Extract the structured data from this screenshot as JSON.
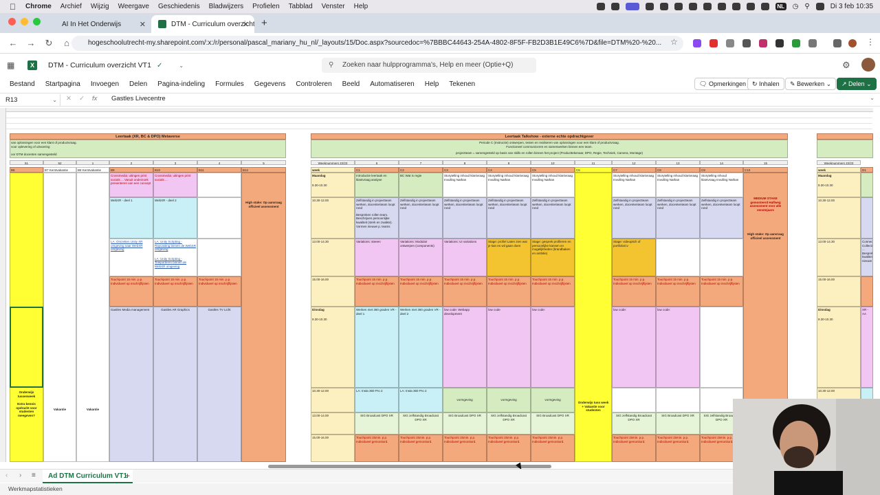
{
  "mac": {
    "menus": [
      "Chrome",
      "Archief",
      "Wijzig",
      "Weergave",
      "Geschiedenis",
      "Bladwijzers",
      "Profielen",
      "Tabblad",
      "Venster",
      "Help"
    ],
    "clock": "Di 3 feb 10:35",
    "input_lang": "NL"
  },
  "browser": {
    "tabs": [
      {
        "title": "AI In Het Onderwijs",
        "active": false
      },
      {
        "title": "DTM - Curriculum overzicht V",
        "active": true
      }
    ],
    "url": "hogeschoolutrecht-my.sharepoint.com/:x:/r/personal/pascal_mariany_hu_nl/_layouts/15/Doc.aspx?sourcedoc=%7BBBC44643-254A-4802-8F5F-FB2D3B1E49C6%7D&file=DTM%20-%20..."
  },
  "excel": {
    "doc_title": "DTM - Curriculum overzicht VT1",
    "search_placeholder": "Zoeken naar hulpprogramma's, Help en meer (Optie+Q)",
    "ribbon_tabs": [
      "Bestand",
      "Startpagina",
      "Invoegen",
      "Delen",
      "Pagina-indeling",
      "Formules",
      "Gegevens",
      "Controleren",
      "Beeld",
      "Automatiseren",
      "Help",
      "Tekenen"
    ],
    "btn_comments": "Opmerkingen",
    "btn_catchup": "Inhalen",
    "btn_edit": "Bewerken",
    "btn_share": "Delen",
    "name_box": "R13",
    "formula_value": "Gastles Livecentre",
    "sheet_tab": "Ad DTM Curriculum VT1",
    "status_text": "Werkmapstatistieken"
  },
  "sheet": {
    "left_title": "Leertaak (XR, BC & DPO) Metaverse",
    "left_sub1": "van oplossingen voor een klant of productvraag.",
    "left_sub2": "voor oplevering of uitvoering",
    "left_sub3": "oor DTM docenten samengesteld",
    "right_title": "Leertaak Talkshow - externe echte opdrachtgever",
    "right_sub1": "Periode C (Instructie) ontwerpen, testen en realiseren van oplossingen voor een klant of productvraag.",
    "right_sub2": "Functioneel communiceren en samenwerken binnen een team.",
    "right_sub3": "projectteam = samengesteld op basis van skills en rollen binnen het project (Producttekenaar, DPO, Regie, Techniek, Camera, Montage)",
    "weeknr_label": "Weeknummers 22/23",
    "week_label": "week",
    "left_weeks": [
      "51",
      "52",
      "1",
      "2",
      "3",
      "4",
      "5"
    ],
    "left_codes": [
      "B6",
      "B7 Kerstvakantie",
      "B8 Kerstvakantie",
      "B9",
      "B10",
      "B11",
      "B12"
    ],
    "right_weeks": [
      "6",
      "7",
      "8",
      "9",
      "10",
      "11",
      "12",
      "13",
      "14",
      "15"
    ],
    "right_codes": [
      "C1",
      "C2",
      "C3",
      "C4",
      "C5",
      "C6",
      "C7",
      "C8",
      "C9",
      "C10"
    ],
    "monday": "Maandag",
    "tuesday": "Dinsdag",
    "t1": "9.30-10.30",
    "t2": "10.30-12.00",
    "t3": "13.00-14.30",
    "t4": "15.00-16.00",
    "t5": "9.30-10.30",
    "t6": "10.30-12.00",
    "t7": "13.00-14.00",
    "t8": "15.00-16.00",
    "crossmedia": "Crossmedia: uitingen print socials ... Vanuit onderzoek presenteren van een concept",
    "crossmedia2": "Crossmedia: uitingen print socials ...",
    "webxr1": "WebXR - deel 1",
    "webxr2": "WebXR - deel 2",
    "unity1": "LA: Omzetten Unity XR omgeving naar WebXR omgeving",
    "unity2": "LA: Unity Scripting - Raycasting binnen de WebXR omgeving",
    "unity3": "LA: Unity Scripting - Teleporteren binnen de WebXR omgeving",
    "touchpoint": "Touchpoint 15 min. p.p. Individueel op inschrijflijsten",
    "gastles1": "Gastles Media management",
    "gastles2": "Gastles AR Graphics",
    "gastles3": "Gastles TV Licht",
    "highstake": "High stake: Op aanvraag officieel assessment",
    "onderwijs": "Onderwijs tussenweek",
    "extra": "Extra kennis opdracht voor studenten meegeven?",
    "vakantie": "Vakantie",
    "intro": "Introductie leertaak en klantvraag analyse",
    "bcwat": "BC Wat is regie",
    "story": "Storytelling inhoud klantvraag Invulling Nathan",
    "zelf": "Zelfstandig in projectteam werken, docententeam loopt rond",
    "zelf2": "Bespreken rollen team. Beschrijven persoonlijke kwaliteit (sterk en zwakte). Vormen nieuwe p. teams",
    "variations1": "Variations: steeen",
    "variations2": "Variations: Modulair ontwerpen (components)",
    "variations3": "Variations: UI variations",
    "stage1": "Stage: profiel Laten zien wat je kan en wil gaan doen",
    "stage2": "Stage: gesprek profileren en persoonlijke kansen en mogelijkheden (brandbaken en ambitie)",
    "stage3": "Stage: videopitch of portfolio/cv",
    "medium": "MEDIUM STAKE gemonteerd Halfweg assessment voor alle eenstejaars",
    "highstake2": "High stake: Op aanvraag officieel assessment",
    "vr1": "Werken met 360 graden VR - deel 1",
    "vr2": "Werken met 360 graden VR - deel 2",
    "lowcode1": "low code: Webapp development",
    "lowcode": "low code",
    "lowcode2": "low code:",
    "insta": "LA: Insta 360 Pro 2",
    "vorm": "vormgeving",
    "sig": "SIG Broadcast DPO XR",
    "sigz": "SIG zelfstandig Broadcast DPO XR",
    "tuss": "Onderwijs tuss week + Vakantie voor studenten",
    "touch2": "Touchpoint 15min. p.p. Individueel gemonitord.",
    "right_edge_code": "D1",
    "right_edge_xr": "XR - AA",
    "right_edge_connect": "Connecti Collectie ... Bespreki kwaliteit nieuwe"
  },
  "colors": {
    "yellow": "#ffff33",
    "orange": "#f4a97c",
    "green": "#d5ecc0",
    "cream": "#fcefc0",
    "lightblue": "#c9f0f6",
    "lavender": "#d7d9f0",
    "pink": "#f2c6f2",
    "gold": "#f4c430",
    "lightgreen": "#e6f5d8",
    "excel_green": "#1e7145"
  }
}
